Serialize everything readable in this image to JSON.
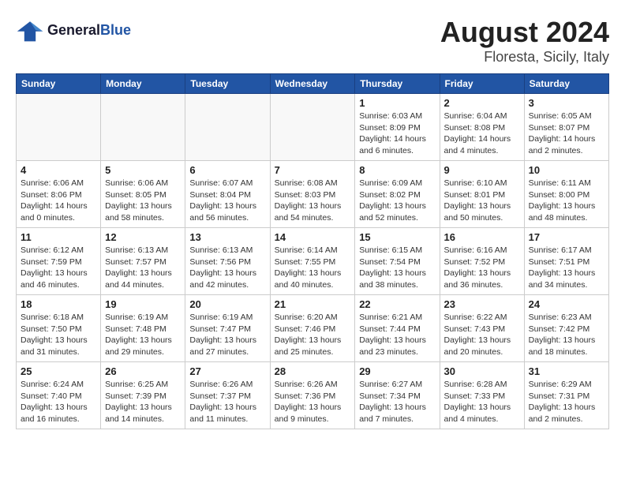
{
  "logo": {
    "line1": "General",
    "line2": "Blue"
  },
  "title": "August 2024",
  "location": "Floresta, Sicily, Italy",
  "days_of_week": [
    "Sunday",
    "Monday",
    "Tuesday",
    "Wednesday",
    "Thursday",
    "Friday",
    "Saturday"
  ],
  "weeks": [
    [
      {
        "day": "",
        "info": ""
      },
      {
        "day": "",
        "info": ""
      },
      {
        "day": "",
        "info": ""
      },
      {
        "day": "",
        "info": ""
      },
      {
        "day": "1",
        "info": "Sunrise: 6:03 AM\nSunset: 8:09 PM\nDaylight: 14 hours\nand 6 minutes."
      },
      {
        "day": "2",
        "info": "Sunrise: 6:04 AM\nSunset: 8:08 PM\nDaylight: 14 hours\nand 4 minutes."
      },
      {
        "day": "3",
        "info": "Sunrise: 6:05 AM\nSunset: 8:07 PM\nDaylight: 14 hours\nand 2 minutes."
      }
    ],
    [
      {
        "day": "4",
        "info": "Sunrise: 6:06 AM\nSunset: 8:06 PM\nDaylight: 14 hours\nand 0 minutes."
      },
      {
        "day": "5",
        "info": "Sunrise: 6:06 AM\nSunset: 8:05 PM\nDaylight: 13 hours\nand 58 minutes."
      },
      {
        "day": "6",
        "info": "Sunrise: 6:07 AM\nSunset: 8:04 PM\nDaylight: 13 hours\nand 56 minutes."
      },
      {
        "day": "7",
        "info": "Sunrise: 6:08 AM\nSunset: 8:03 PM\nDaylight: 13 hours\nand 54 minutes."
      },
      {
        "day": "8",
        "info": "Sunrise: 6:09 AM\nSunset: 8:02 PM\nDaylight: 13 hours\nand 52 minutes."
      },
      {
        "day": "9",
        "info": "Sunrise: 6:10 AM\nSunset: 8:01 PM\nDaylight: 13 hours\nand 50 minutes."
      },
      {
        "day": "10",
        "info": "Sunrise: 6:11 AM\nSunset: 8:00 PM\nDaylight: 13 hours\nand 48 minutes."
      }
    ],
    [
      {
        "day": "11",
        "info": "Sunrise: 6:12 AM\nSunset: 7:59 PM\nDaylight: 13 hours\nand 46 minutes."
      },
      {
        "day": "12",
        "info": "Sunrise: 6:13 AM\nSunset: 7:57 PM\nDaylight: 13 hours\nand 44 minutes."
      },
      {
        "day": "13",
        "info": "Sunrise: 6:13 AM\nSunset: 7:56 PM\nDaylight: 13 hours\nand 42 minutes."
      },
      {
        "day": "14",
        "info": "Sunrise: 6:14 AM\nSunset: 7:55 PM\nDaylight: 13 hours\nand 40 minutes."
      },
      {
        "day": "15",
        "info": "Sunrise: 6:15 AM\nSunset: 7:54 PM\nDaylight: 13 hours\nand 38 minutes."
      },
      {
        "day": "16",
        "info": "Sunrise: 6:16 AM\nSunset: 7:52 PM\nDaylight: 13 hours\nand 36 minutes."
      },
      {
        "day": "17",
        "info": "Sunrise: 6:17 AM\nSunset: 7:51 PM\nDaylight: 13 hours\nand 34 minutes."
      }
    ],
    [
      {
        "day": "18",
        "info": "Sunrise: 6:18 AM\nSunset: 7:50 PM\nDaylight: 13 hours\nand 31 minutes."
      },
      {
        "day": "19",
        "info": "Sunrise: 6:19 AM\nSunset: 7:48 PM\nDaylight: 13 hours\nand 29 minutes."
      },
      {
        "day": "20",
        "info": "Sunrise: 6:19 AM\nSunset: 7:47 PM\nDaylight: 13 hours\nand 27 minutes."
      },
      {
        "day": "21",
        "info": "Sunrise: 6:20 AM\nSunset: 7:46 PM\nDaylight: 13 hours\nand 25 minutes."
      },
      {
        "day": "22",
        "info": "Sunrise: 6:21 AM\nSunset: 7:44 PM\nDaylight: 13 hours\nand 23 minutes."
      },
      {
        "day": "23",
        "info": "Sunrise: 6:22 AM\nSunset: 7:43 PM\nDaylight: 13 hours\nand 20 minutes."
      },
      {
        "day": "24",
        "info": "Sunrise: 6:23 AM\nSunset: 7:42 PM\nDaylight: 13 hours\nand 18 minutes."
      }
    ],
    [
      {
        "day": "25",
        "info": "Sunrise: 6:24 AM\nSunset: 7:40 PM\nDaylight: 13 hours\nand 16 minutes."
      },
      {
        "day": "26",
        "info": "Sunrise: 6:25 AM\nSunset: 7:39 PM\nDaylight: 13 hours\nand 14 minutes."
      },
      {
        "day": "27",
        "info": "Sunrise: 6:26 AM\nSunset: 7:37 PM\nDaylight: 13 hours\nand 11 minutes."
      },
      {
        "day": "28",
        "info": "Sunrise: 6:26 AM\nSunset: 7:36 PM\nDaylight: 13 hours\nand 9 minutes."
      },
      {
        "day": "29",
        "info": "Sunrise: 6:27 AM\nSunset: 7:34 PM\nDaylight: 13 hours\nand 7 minutes."
      },
      {
        "day": "30",
        "info": "Sunrise: 6:28 AM\nSunset: 7:33 PM\nDaylight: 13 hours\nand 4 minutes."
      },
      {
        "day": "31",
        "info": "Sunrise: 6:29 AM\nSunset: 7:31 PM\nDaylight: 13 hours\nand 2 minutes."
      }
    ]
  ]
}
